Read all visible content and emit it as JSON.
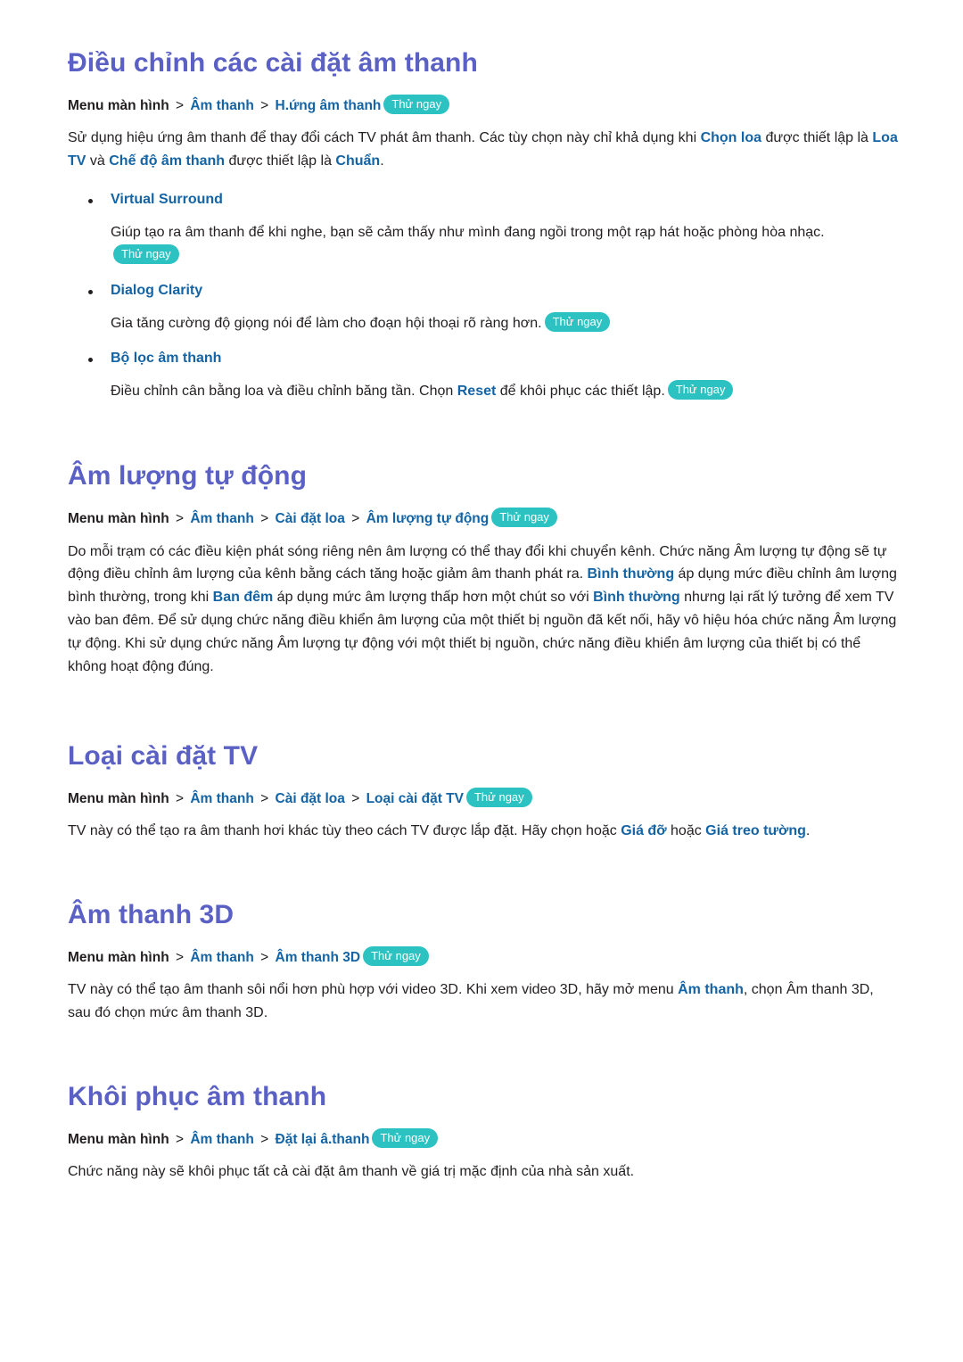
{
  "sections": [
    {
      "id": "sound-settings",
      "title": "Điều chỉnh các cài đặt âm thanh",
      "breadcrumb": {
        "root": "Menu màn hình",
        "links": [
          "Âm thanh",
          "H.ứng âm thanh"
        ],
        "separator": ">",
        "badge": "Thử ngay"
      },
      "intro": {
        "p1_a": "Sử dụng hiệu ứng âm thanh để thay đổi cách TV phát âm thanh. Các tùy chọn này chỉ khả dụng khi ",
        "p1_b1": "Chọn loa",
        "p1_c": " được thiết lập là ",
        "p1_b2": "Loa TV",
        "p1_d": " và ",
        "p1_b3": "Chế độ âm thanh",
        "p1_e": " được thiết lập là ",
        "p1_b4": "Chuẩn",
        "p1_f": "."
      },
      "bullets": [
        {
          "title": "Virtual Surround",
          "text_a": "Giúp tạo ra âm thanh để khi nghe, bạn sẽ cảm thấy như mình đang ngồi trong một rạp hát hoặc phòng hòa nhạc.",
          "badge": "Thử ngay"
        },
        {
          "title": "Dialog Clarity",
          "text_a": "Gia tăng cường độ giọng nói để làm cho đoạn hội thoại rõ ràng hơn.",
          "badge": "Thử ngay"
        },
        {
          "title": "Bộ lọc âm thanh",
          "text_a": "Điều chỉnh cân bằng loa và điều chỉnh băng tần. Chọn ",
          "text_b": "Reset",
          "text_c": " để khôi phục các thiết lập.",
          "badge": "Thử ngay"
        }
      ]
    },
    {
      "id": "auto-volume",
      "title": "Âm lượng tự động",
      "breadcrumb": {
        "root": "Menu màn hình",
        "links": [
          "Âm thanh",
          "Cài đặt loa",
          "Âm lượng tự động"
        ],
        "separator": ">",
        "badge": "Thử ngay"
      },
      "body": {
        "a": "Do mỗi trạm có các điều kiện phát sóng riêng nên âm lượng có thể thay đổi khi chuyển kênh. Chức năng Âm lượng tự động sẽ tự động điều chỉnh âm lượng của kênh bằng cách tăng hoặc giảm âm thanh phát ra. ",
        "b1": "Bình thường",
        "c": " áp dụng mức điều chỉnh âm lượng bình thường, trong khi ",
        "b2": "Ban đêm",
        "d": " áp dụng mức âm lượng thấp hơn một chút so với ",
        "b3": "Bình thường",
        "e": " nhưng lại rất lý tưởng để xem TV vào ban đêm. Để sử dụng chức năng điều khiển âm lượng của một thiết bị nguồn đã kết nối, hãy vô hiệu hóa chức năng Âm lượng tự động. Khi sử dụng chức năng Âm lượng tự động với một thiết bị nguồn, chức năng điều khiển âm lượng của thiết bị có thể không hoạt động đúng."
      }
    },
    {
      "id": "tv-install-type",
      "title": "Loại cài đặt TV",
      "breadcrumb": {
        "root": "Menu màn hình",
        "links": [
          "Âm thanh",
          "Cài đặt loa",
          "Loại cài đặt TV"
        ],
        "separator": ">",
        "badge": "Thử ngay"
      },
      "body": {
        "a": "TV này có thể tạo ra âm thanh hơi khác tùy theo cách TV được lắp đặt. Hãy chọn hoặc ",
        "b1": "Giá đỡ",
        "c": " hoặc ",
        "b2": "Giá treo tường",
        "d": "."
      }
    },
    {
      "id": "sound-3d",
      "title": "Âm thanh 3D",
      "breadcrumb": {
        "root": "Menu màn hình",
        "links": [
          "Âm thanh",
          "Âm thanh 3D"
        ],
        "separator": ">",
        "badge": "Thử ngay"
      },
      "body": {
        "a": "TV này có thể tạo âm thanh sôi nổi hơn phù hợp với video 3D. Khi xem video 3D, hãy mở menu ",
        "b1": "Âm thanh",
        "c": ", chọn Âm thanh 3D, sau đó chọn mức âm thanh 3D."
      }
    },
    {
      "id": "sound-reset",
      "title": "Khôi phục âm thanh",
      "breadcrumb": {
        "root": "Menu màn hình",
        "links": [
          "Âm thanh",
          "Đặt lại â.thanh"
        ],
        "separator": ">",
        "badge": "Thử ngay"
      },
      "body": {
        "a": "Chức năng này sẽ khôi phục tất cả cài đặt âm thanh về giá trị mặc định của nhà sản xuất."
      }
    }
  ],
  "colors": {
    "heading": "#5b61c4",
    "link": "#1464a5",
    "badge_bg": "#2cc2c2",
    "badge_text": "#ffffff",
    "body_text": "#231f20",
    "page_bg": "#ffffff"
  }
}
